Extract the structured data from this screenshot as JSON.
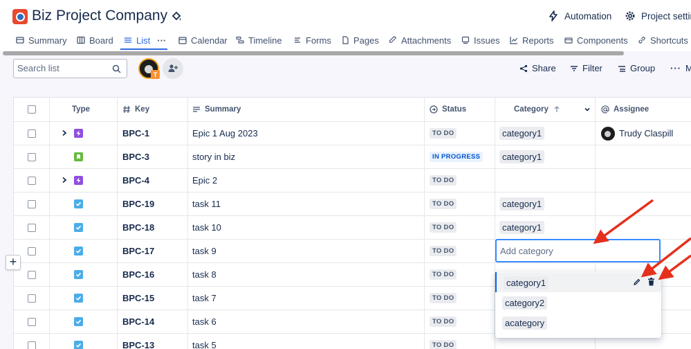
{
  "project": {
    "title": "Biz Project Company"
  },
  "header_actions": {
    "automation": "Automation",
    "settings": "Project settin"
  },
  "tabs": [
    {
      "label": "Summary"
    },
    {
      "label": "Board"
    },
    {
      "label": "List",
      "more": "···"
    },
    {
      "label": "Calendar"
    },
    {
      "label": "Timeline"
    },
    {
      "label": "Forms"
    },
    {
      "label": "Pages"
    },
    {
      "label": "Attachments"
    },
    {
      "label": "Issues"
    },
    {
      "label": "Reports"
    },
    {
      "label": "Components"
    },
    {
      "label": "Shortcuts"
    }
  ],
  "toolbar": {
    "search_placeholder": "Search list",
    "avatar_badge": "T",
    "share": "Share",
    "filter": "Filter",
    "group": "Group",
    "more": "Mo"
  },
  "columns": {
    "type": "Type",
    "key": "Key",
    "summary": "Summary",
    "status": "Status",
    "category": "Category",
    "assignee": "Assignee"
  },
  "rows": [
    {
      "type": "epic",
      "expandable": true,
      "key": "BPC-1",
      "summary": "Epic 1 Aug 2023",
      "status": "TO DO",
      "category": "category1",
      "assignee": "Trudy Claspill"
    },
    {
      "type": "story",
      "expandable": false,
      "key": "BPC-3",
      "summary": "story in biz",
      "status": "IN PROGRESS",
      "category": "category1",
      "assignee": ""
    },
    {
      "type": "epic",
      "expandable": true,
      "key": "BPC-4",
      "summary": "Epic 2",
      "status": "TO DO",
      "category": "",
      "assignee": ""
    },
    {
      "type": "task",
      "expandable": false,
      "key": "BPC-19",
      "summary": "task 11",
      "status": "TO DO",
      "category": "category1",
      "assignee": ""
    },
    {
      "type": "task",
      "expandable": false,
      "key": "BPC-18",
      "summary": "task 10",
      "status": "TO DO",
      "category": "category1",
      "assignee": ""
    },
    {
      "type": "task",
      "expandable": false,
      "key": "BPC-17",
      "summary": "task 9",
      "status": "TO DO",
      "category": "",
      "assignee": ""
    },
    {
      "type": "task",
      "expandable": false,
      "key": "BPC-16",
      "summary": "task 8",
      "status": "TO DO",
      "category": "",
      "assignee": ""
    },
    {
      "type": "task",
      "expandable": false,
      "key": "BPC-15",
      "summary": "task 7",
      "status": "TO DO",
      "category": "",
      "assignee": ""
    },
    {
      "type": "task",
      "expandable": false,
      "key": "BPC-14",
      "summary": "task 6",
      "status": "TO DO",
      "category": "",
      "assignee": ""
    },
    {
      "type": "task",
      "expandable": false,
      "key": "BPC-13",
      "summary": "task 5",
      "status": "TO DO",
      "category": "",
      "assignee": ""
    }
  ],
  "row_plus": "+",
  "category_editor": {
    "placeholder": "Add category",
    "options": [
      {
        "label": "category1",
        "selected": true
      },
      {
        "label": "category2",
        "selected": false
      },
      {
        "label": "acategory",
        "selected": false
      }
    ]
  },
  "colors": {
    "accent": "#2f6be0",
    "epic": "#904ee2",
    "story": "#63ba3c",
    "task": "#4bade8",
    "annotation_arrow": "#e5301d"
  }
}
